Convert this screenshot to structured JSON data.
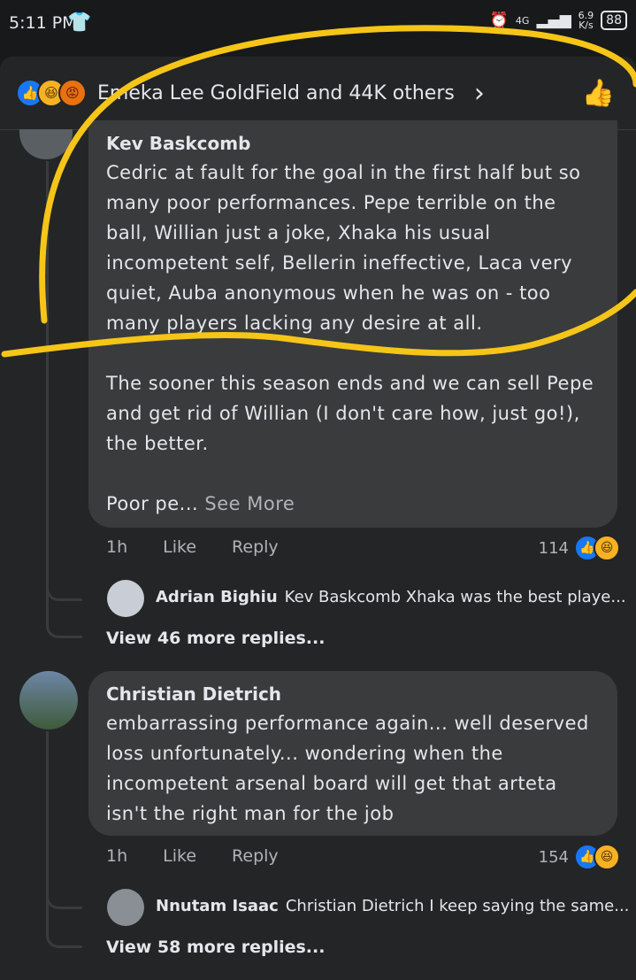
{
  "status_bar": {
    "time": "5:11 PM",
    "signal_label": "4G",
    "net_speed_value": "6.9",
    "net_speed_unit": "K/s",
    "battery": "88"
  },
  "reactions": {
    "text": "Emeka Lee GoldField and 44K others"
  },
  "comments": [
    {
      "author": "Kev Baskcomb",
      "paragraphs": [
        "Cedric at fault for the goal in the first half but so many poor performances. Pepe terrible on the ball, Willian just a joke, Xhaka his usual incompetent self, Bellerin ineffective, Laca very quiet, Auba anonymous when he was on - too many players lacking any desire at all.",
        "The sooner this season ends and we can sell Pepe and get rid of Willian (I don't care how, just go!), the better.",
        "Poor pe..."
      ],
      "see_more": "See More",
      "time": "1h",
      "like_label": "Like",
      "reply_label": "Reply",
      "reaction_count": "114",
      "reply": {
        "author": "Adrian Bighiu",
        "text": "Kev Baskcomb Xhaka was the best playe..."
      },
      "view_more": "View 46 more replies..."
    },
    {
      "author": "Christian Dietrich",
      "paragraphs": [
        "embarrassing performance again... well deserved loss unfortunately... wondering when the incompetent arsenal board will get that arteta isn't the right man for the job"
      ],
      "time": "1h",
      "like_label": "Like",
      "reply_label": "Reply",
      "reaction_count": "154",
      "reply": {
        "author": "Nnutam Isaac",
        "text": "Christian Dietrich I keep saying the same..."
      },
      "view_more": "View 58 more replies..."
    }
  ],
  "colors": {
    "background": "#18191a",
    "panel": "#242526",
    "bubble": "#3a3b3c",
    "accent_like": "#1877f2",
    "annotation": "#f5c518"
  }
}
